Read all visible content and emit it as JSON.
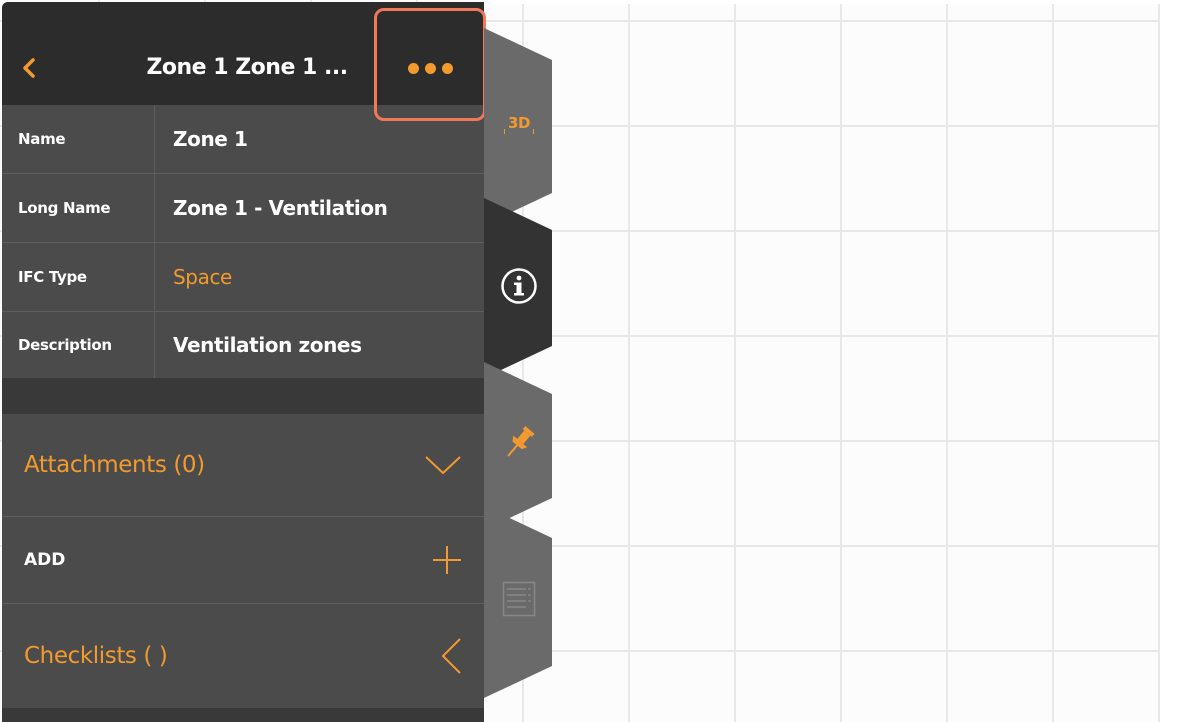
{
  "header": {
    "back_icon": "chevron-left-icon",
    "title": "Zone 1 Zone 1 ...",
    "more_icon": "more-horizontal-icon"
  },
  "properties": [
    {
      "label": "Name",
      "value": "Zone 1",
      "is_link": false
    },
    {
      "label": "Long Name",
      "value": "Zone 1 - Ventilation",
      "is_link": false
    },
    {
      "label": "IFC Type",
      "value": "Space",
      "is_link": true
    },
    {
      "label": "Description",
      "value": "Ventilation zones",
      "is_link": false
    }
  ],
  "attachments": {
    "title": "Attachments (0)",
    "icon": "chevron-down-icon"
  },
  "add": {
    "label": "ADD",
    "icon": "plus-icon"
  },
  "checklists": {
    "title": "Checklists (  )",
    "icon": "chevron-left-icon"
  },
  "side_tabs": {
    "tab_3d": "3D",
    "info_icon": "info-icon",
    "pin_icon": "pushpin-icon",
    "list_icon": "checklist-icon"
  },
  "colors": {
    "accent": "#f29a2e",
    "highlight": "#f2785a",
    "panel": "#4b4b4b",
    "header": "#2c2c2c"
  }
}
